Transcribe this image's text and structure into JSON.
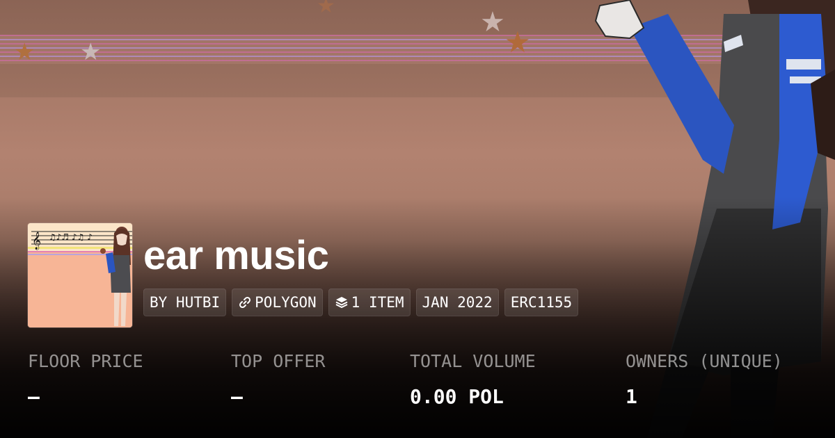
{
  "collection": {
    "title": "ear music",
    "tags": [
      {
        "label": "BY HUTBI",
        "icon": null
      },
      {
        "label": "POLYGON",
        "icon": "link-icon"
      },
      {
        "label": "1 ITEM",
        "icon": "layers-icon"
      },
      {
        "label": "JAN 2022",
        "icon": null
      },
      {
        "label": "ERC1155",
        "icon": null
      }
    ]
  },
  "stats": [
    {
      "label": "FLOOR PRICE",
      "value": "—"
    },
    {
      "label": "TOP OFFER",
      "value": "—"
    },
    {
      "label": "TOTAL VOLUME",
      "value": "0.00 POL"
    },
    {
      "label": "OWNERS (UNIQUE)",
      "value": "1"
    }
  ],
  "colors": {
    "background_top": "#9a6f5e",
    "background_mid": "#b28270",
    "tag_background": "rgba(255,255,255,0.1)",
    "label_text": "rgba(255,255,255,0.55)",
    "value_text": "#ffffff"
  }
}
